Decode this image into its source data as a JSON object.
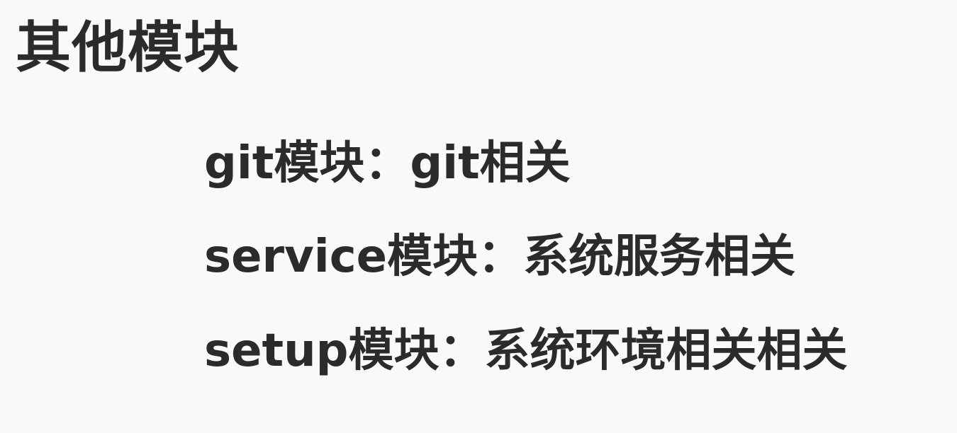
{
  "slide": {
    "title": "其他模块",
    "items": [
      {
        "text": "git模块：git相关"
      },
      {
        "text": "service模块：系统服务相关"
      },
      {
        "text": "setup模块：系统环境相关相关"
      }
    ]
  }
}
